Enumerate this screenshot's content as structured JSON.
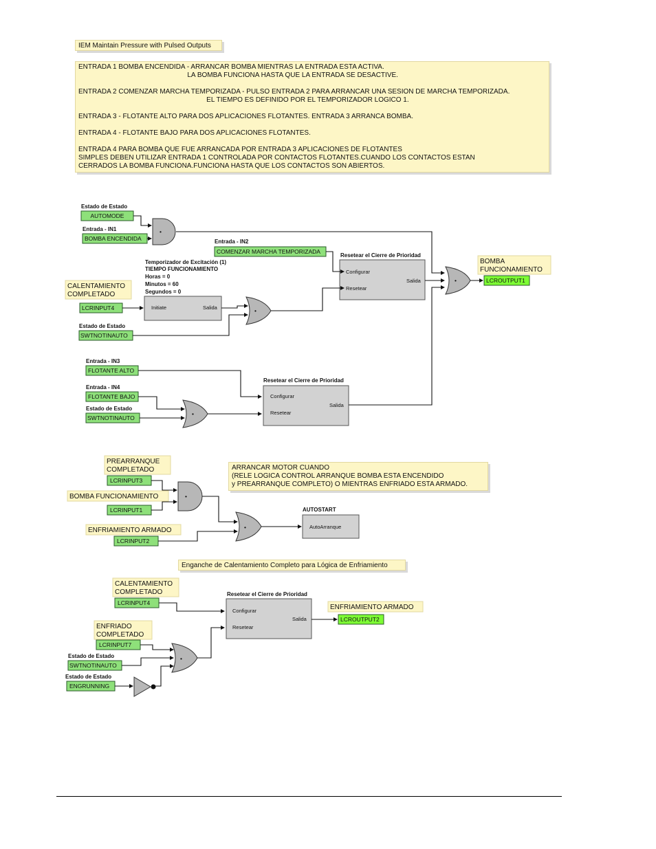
{
  "title_note": "IEM Maintain Pressure with Pulsed Outputs",
  "description_note": "ENTRADA 1 BOMBA ENCENDIDA - ARRANCAR BOMBA MIENTRAS LA ENTRADA ESTA ACTIVA.\n                                                         LA BOMBA FUNCIONA HASTA QUE LA ENTRADA SE DESACTIVE.\n\nENTRADA 2 COMENZAR MARCHA TEMPORIZADA - PULSO ENTRADA 2 PARA ARRANCAR UNA SESION DE MARCHA TEMPORIZADA.\n                                                                   EL TIEMPO ES DEFINIDO POR EL TEMPORIZADOR LOGICO 1.\n\nENTRADA 3 - FLOTANTE ALTO PARA DOS APLICACIONES FLOTANTES. ENTRADA 3 ARRANCA BOMBA.\n\nENTRADA 4 - FLOTANTE BAJO PARA DOS APLICACIONES FLOTANTES.\n\nENTRADA 4 PARA BOMBA QUE FUE ARRANCADA POR ENTRADA 3 APLICACIONES DE FLOTANTES\nSIMPLES DEBEN UTILIZAR ENTRADA 1 CONTROLADA POR CONTACTOS FLOTANTES.CUANDO LOS CONTACTOS ESTAN\nCERRADOS LA BOMBA FUNCIONA.FUNCIONA HASTA QUE LOS CONTACTOS SON ABIERTOS.",
  "autostart_note": "ARRANCAR MOTOR CUANDO\n(RELE LOGICA CONTROL ARRANQUE BOMBA ESTA ENCENDIDO\ny PREARRANQUE COMPLETO) O MIENTRAS ENFRIADO ESTA ARMADO.",
  "latch_note": "Enganche de Calentamiento Completo para Lógica de Enfriamiento",
  "colors": {
    "note_fill": "#fdf6c6",
    "input_fill": "#8ee07a",
    "output_fill": "#7dfc34",
    "block_fill": "#d2d2d2",
    "gate_fill": "#b7b7b7"
  },
  "gate_symbol": "•",
  "section1": {
    "lbl_estado1": "Estado de Estado",
    "in_automode": "AUTOMODE",
    "lbl_in1": "Entrada - IN1",
    "in_bomba": "BOMBA ENCENDIDA",
    "lbl_in2": "Entrada - IN2",
    "in_comenzar": "COMENZAR MARCHA TEMPORIZADA",
    "timer_title": "Temporizador de Excitación (1)",
    "timer_name": "TIEMPO FUNCIONAMIENTO",
    "timer_horas": "Horas = 0",
    "timer_minutos": "Minutos = 60",
    "timer_segundos": "Segundos = 0",
    "timer_in_port": "Initiate",
    "timer_out_port": "Salida",
    "tag_calent": "CALENTAMIENTO\nCOMPLETADO",
    "in_lcrinput4": "LCRINPUT4",
    "lbl_estado2": "Estado de Estado",
    "in_swtnot1": "SWTNOTINAUTO",
    "latch1_title": "Resetear el Cierre de Prioridad",
    "latch1_set": "Configurar",
    "latch1_reset": "Resetear",
    "latch1_out": "Salida",
    "tag_bomba_func": "BOMBA\nFUNCIONAMIENTO",
    "out_lcroutput1": "LCROUTPUT1",
    "lbl_in3": "Entrada - IN3",
    "in_flot_alto": "FLOTANTE ALTO",
    "lbl_in4": "Entrada - IN4",
    "in_flot_bajo": "FLOTANTE BAJO",
    "lbl_estado3": "Estado de Estado",
    "in_swtnot2": "SWTNOTINAUTO",
    "latch2_title": "Resetear el Cierre de Prioridad",
    "latch2_set": "Configurar",
    "latch2_reset": "Resetear",
    "latch2_out": "Salida"
  },
  "section2": {
    "tag_prearranque": "PREARRANQUE\nCOMPLETADO",
    "in_lcrinput3": "LCRINPUT3",
    "tag_bomba_func": "BOMBA FUNCIONAMIENTO",
    "in_lcrinput1": "LCRINPUT1",
    "tag_enfr_armado": "ENFRIAMIENTO ARMADO",
    "in_lcrinput2": "LCRINPUT2",
    "autostart_title": "AUTOSTART",
    "autostart_port": "AutoArranque"
  },
  "section3": {
    "tag_calent": "CALENTAMIENTO\nCOMPLETADO",
    "in_lcrinput4": "LCRINPUT4",
    "latch_title": "Resetear el Cierre de Prioridad",
    "latch_set": "Configurar",
    "latch_reset": "Resetear",
    "latch_out": "Salida",
    "tag_enfr_armado": "ENFRIAMIENTO ARMADO",
    "out_lcroutput2": "LCROUTPUT2",
    "tag_enfriado": "ENFRIADO\nCOMPLETADO",
    "in_lcrinput7": "LCRINPUT7",
    "lbl_estado1": "Estado de Estado",
    "in_swtnot": "SWTNOTINAUTO",
    "lbl_estado2": "Estado de Estado",
    "in_engrunning": "ENGRUNNING"
  }
}
